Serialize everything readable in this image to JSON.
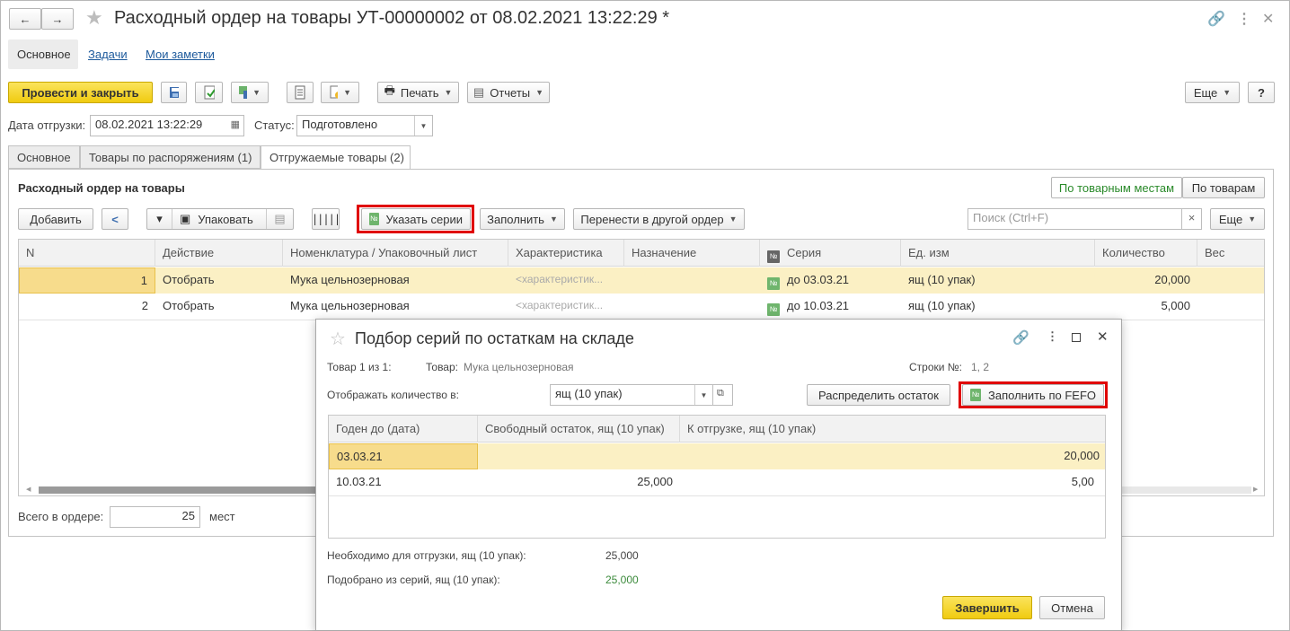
{
  "window": {
    "title": "Расходный ордер на товары УТ-00000002 от 08.02.2021 13:22:29 *",
    "nav_back": "←",
    "nav_forward": "→"
  },
  "section_tabs": [
    {
      "label": "Основное"
    },
    {
      "label": "Задачи"
    },
    {
      "label": "Мои заметки"
    }
  ],
  "toolbar": {
    "post_close": "Провести и закрыть",
    "print": "Печать",
    "reports": "Отчеты",
    "more": "Еще",
    "help": "?"
  },
  "header_fields": {
    "ship_date_label": "Дата отгрузки:",
    "ship_date_value": "08.02.2021 13:22:29",
    "status_label": "Статус:",
    "status_value": "Подготовлено"
  },
  "doc_tabs": [
    {
      "label": "Основное"
    },
    {
      "label": "Товары по распоряжениям (1)"
    },
    {
      "label": "Отгружаемые товары (2)"
    }
  ],
  "panel": {
    "title": "Расходный ордер на товары",
    "view_by_places": "По товарным местам",
    "view_by_goods": "По товарам",
    "add": "Добавить",
    "pack": "Упаковать",
    "specify_series": "Указать серии",
    "fill": "Заполнить",
    "move_order": "Перенести в другой ордер",
    "search_placeholder": "Поиск (Ctrl+F)",
    "more": "Еще"
  },
  "main_table": {
    "columns": [
      "N",
      "Действие",
      "Номенклатура / Упаковочный лист",
      "Характеристика",
      "Назначение",
      "Серия",
      "Ед. изм",
      "Количество",
      "Вес"
    ],
    "rows": [
      {
        "n": "1",
        "action": "Отобрать",
        "item": "Мука цельнозерновая",
        "characteristic": "<характеристик...",
        "purpose": "",
        "series": "до 03.03.21",
        "unit": "ящ (10 упак)",
        "qty": "20,000",
        "weight": ""
      },
      {
        "n": "2",
        "action": "Отобрать",
        "item": "Мука цельнозерновая",
        "characteristic": "<характеристик...",
        "purpose": "",
        "series": "до 10.03.21",
        "unit": "ящ (10 упак)",
        "qty": "5,000",
        "weight": ""
      }
    ]
  },
  "footer": {
    "total_label": "Всего в ордере:",
    "total_value": "25",
    "total_unit": "мест"
  },
  "dialog": {
    "title": "Подбор серий по остаткам на складе",
    "item_counter_label": "Товар 1 из 1:",
    "item_label": "Товар:",
    "item_value": "Мука цельнозерновая",
    "rows_label": "Строки №:",
    "rows_value": "1, 2",
    "display_qty_label": "Отображать количество в:",
    "display_qty_value": "ящ (10 упак)",
    "distribute": "Распределить остаток",
    "fill_fefo": "Заполнить по FEFO",
    "columns": [
      "Годен до (дата)",
      "Свободный остаток, ящ (10 упак)",
      "К отгрузке, ящ (10 упак)"
    ],
    "rows": [
      {
        "date": "03.03.21",
        "free": "",
        "ship": "20,000"
      },
      {
        "date": "10.03.21",
        "free": "25,000",
        "ship": "5,00"
      }
    ],
    "need_label": "Необходимо для отгрузки, ящ (10 упак):",
    "need_value": "25,000",
    "picked_label": "Подобрано из серий, ящ (10 упак):",
    "picked_value": "25,000",
    "finish": "Завершить",
    "cancel": "Отмена"
  },
  "colors": {
    "accent_yellow": "#f5d628",
    "selected_row": "#fbf0c4",
    "highlight_red": "#e00000",
    "link_blue": "#1d5a9c",
    "green_value": "#3b8a3b"
  }
}
